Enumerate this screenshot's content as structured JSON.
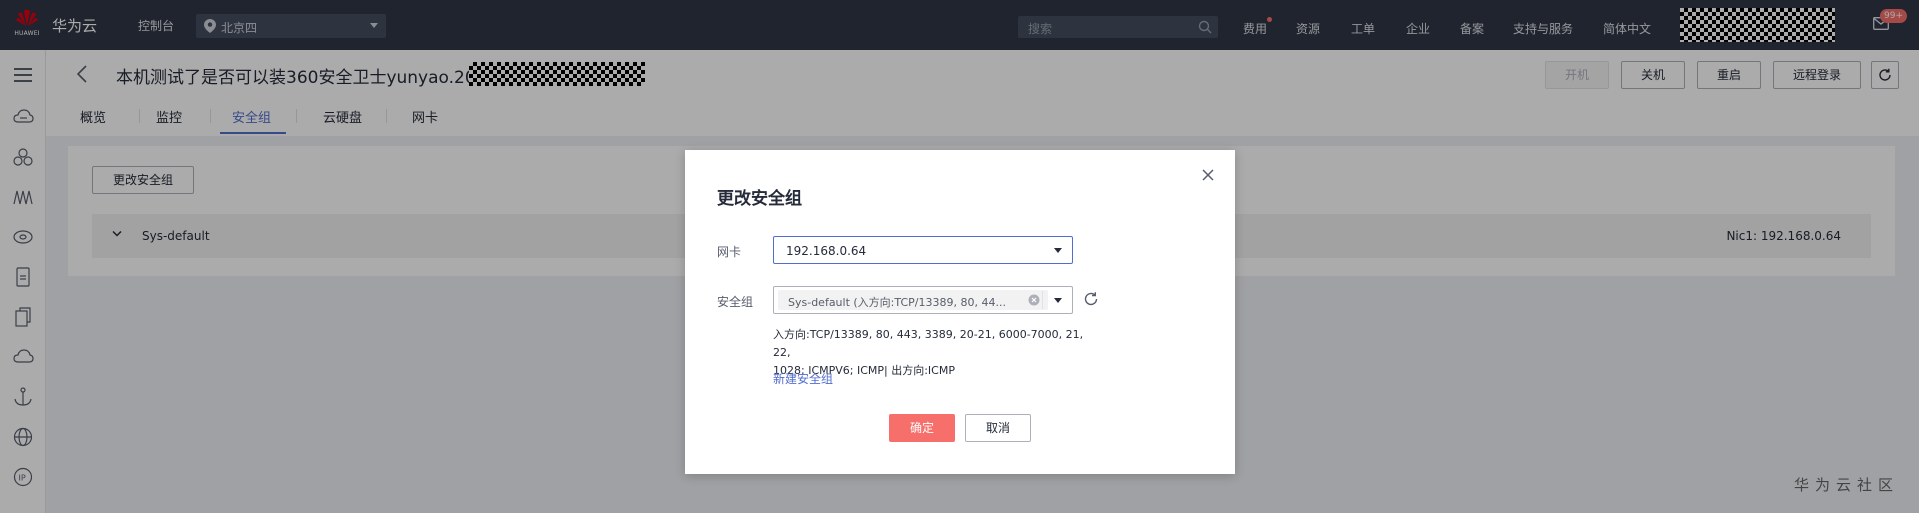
{
  "topbar": {
    "logo_text": "HUAWEI",
    "brand": "华为云",
    "console": "控制台",
    "region": "北京四",
    "search_placeholder": "搜索",
    "nav": [
      "费用",
      "资源",
      "工单",
      "企业",
      "备案",
      "支持与服务",
      "简体中文"
    ],
    "mail_badge": "99+"
  },
  "header": {
    "title": "本机测试了是否可以装360安全卫士yunyao.2020-",
    "buttons": {
      "start": "开机",
      "stop": "关机",
      "restart": "重启",
      "remote": "远程登录"
    },
    "tabs": [
      "概览",
      "监控",
      "安全组",
      "云硬盘",
      "网卡"
    ],
    "active_tab": "安全组"
  },
  "content": {
    "change_button": "更改安全组",
    "sg_name": "Sys-default",
    "sg_nic": "Nic1: 192.168.0.64"
  },
  "dialog": {
    "title": "更改安全组",
    "nic_label": "网卡",
    "nic_value": "192.168.0.64",
    "sg_label": "安全组",
    "sg_value": "Sys-default (入方向:TCP/13389, 80, 44...",
    "rules_line1": "入方向:TCP/13389, 80, 443, 3389, 20-21, 6000-7000, 21, 22,",
    "rules_line2": "1028; ICMPV6; ICMP| 出方向:ICMP",
    "new_sg_link": "新建安全组",
    "ok": "确定",
    "cancel": "取消"
  },
  "watermark": "华为云社区",
  "colors": {
    "topbar": "#2f3747",
    "accent": "#526ecc",
    "primary": "#f66f6a"
  }
}
